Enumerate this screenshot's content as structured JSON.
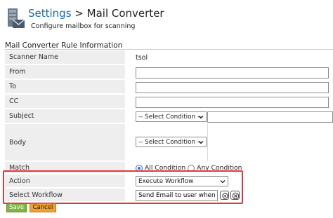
{
  "header": {
    "breadcrumb_root": "Settings",
    "separator": " > ",
    "page_title": "Mail Converter",
    "subtitle": "Configure mailbox for scanning",
    "icon": "mailbox-settings-icon"
  },
  "section": {
    "title": "Mail Converter Rule Information"
  },
  "form": {
    "scanner_name": {
      "label": "Scanner Name",
      "value": "tsol"
    },
    "from": {
      "label": "From",
      "value": ""
    },
    "to": {
      "label": "To",
      "value": ""
    },
    "cc": {
      "label": "CC",
      "value": ""
    },
    "subject": {
      "label": "Subject",
      "condition": "-- Select Condition --",
      "value": ""
    },
    "body": {
      "label": "Body",
      "condition": "-- Select Condition --"
    },
    "match": {
      "label": "Match",
      "option_all": "All Condition",
      "option_any": "Any Condition",
      "selected": "All Condition"
    },
    "action": {
      "label": "Action",
      "value": "Execute Workflow"
    },
    "workflow": {
      "label": "Select Workflow",
      "value": "Send Email to user when N",
      "icons": [
        "search-icon",
        "clear-icon"
      ]
    }
  },
  "buttons": {
    "save": "Save",
    "cancel": "Cancel"
  },
  "colors": {
    "link": "#1a6bb8",
    "highlight": "#e0383e",
    "save": "#7fb640",
    "cancel": "#f0a030"
  }
}
